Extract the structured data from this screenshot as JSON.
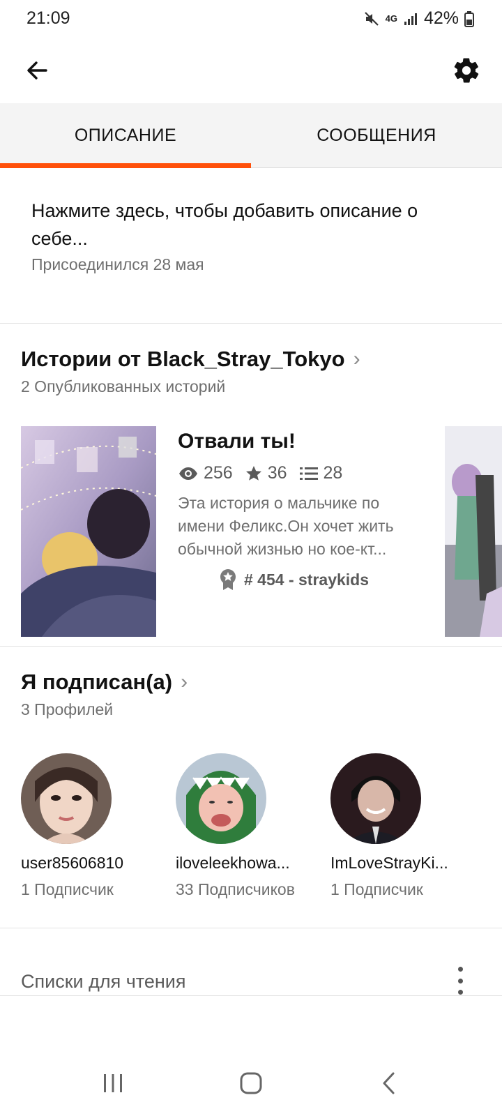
{
  "status_bar": {
    "time": "21:09",
    "network": "4G",
    "battery": "42%"
  },
  "app_bar": {
    "back_icon": "arrow-left-icon",
    "settings_icon": "gear-icon"
  },
  "tabs": [
    {
      "label": "ОПИСАНИЕ",
      "active": true
    },
    {
      "label": "СООБЩЕНИЯ",
      "active": false
    }
  ],
  "accent_color": "#ff500a",
  "description": {
    "placeholder_line1": "Нажмите здесь, чтобы добавить описание о",
    "placeholder_line2": "себе...",
    "joined": "Присоединился 28 мая"
  },
  "stories_section": {
    "title": "Истории от Black_Stray_Tokyo",
    "subtitle": "2 Опубликованных историй",
    "story": {
      "title": "Отвали ты!",
      "views": "256",
      "votes": "36",
      "parts": "28",
      "description_lines": [
        "Эта история о мальчике по",
        "имени Феликс.Он хочет жить",
        "обычной жизнью но кое-кт..."
      ],
      "tag": "# 454 - straykids"
    }
  },
  "following_section": {
    "title": "Я подписан(а)",
    "subtitle": "3 Профилей",
    "profiles": [
      {
        "name": "user85606810",
        "followers": "1 Подписчик"
      },
      {
        "name": "iloveleekhowa...",
        "followers": "33 Подписчиков"
      },
      {
        "name": "ImLoveStrayKi...",
        "followers": "1 Подписчик"
      }
    ]
  },
  "reading_lists": {
    "label": "Списки для чтения"
  }
}
